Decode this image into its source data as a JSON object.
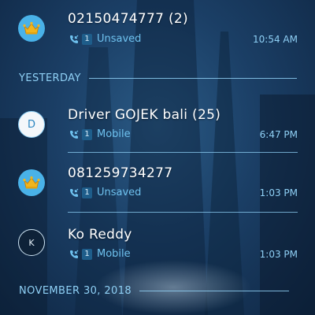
{
  "calls": [
    {
      "name": "02150474777 (2)",
      "sim": "1",
      "type": "Unsaved",
      "time": "10:54 AM",
      "avatar_icon": "crown-icon"
    },
    {
      "name": "Driver GOJEK bali (25)",
      "sim": "1",
      "type": "Mobile",
      "time": "6:47 PM",
      "avatar_letter": "D"
    },
    {
      "name": "081259734277",
      "sim": "1",
      "type": "Unsaved",
      "time": "1:03 PM",
      "avatar_icon": "crown-icon"
    },
    {
      "name": "Ko Reddy",
      "sim": "1",
      "type": "Mobile",
      "time": "1:03 PM",
      "avatar_letter": "K"
    }
  ],
  "sections": {
    "yesterday": "YESTERDAY",
    "nov30": "NOVEMBER 30, 2018"
  },
  "colors": {
    "accent": "#8fd0f5",
    "sub_text": "#6fc2ef",
    "crown_avatar_bg": "#49b2e8",
    "crown_gold": "#f1b51c"
  }
}
